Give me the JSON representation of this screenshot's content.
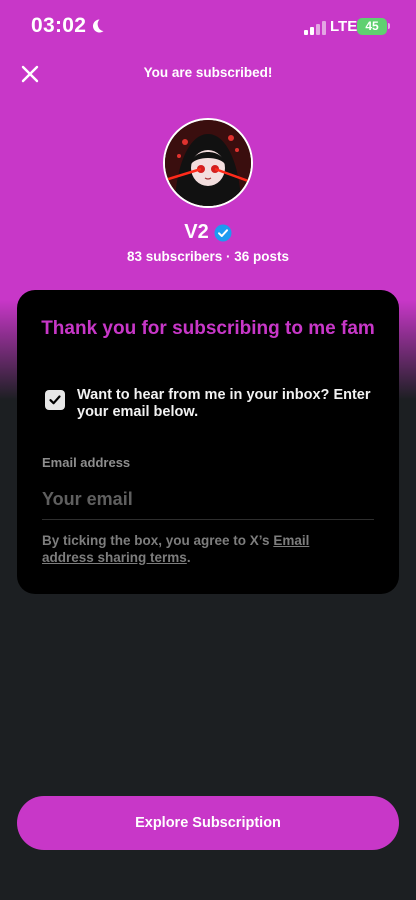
{
  "status_bar": {
    "time": "03:02",
    "network": "LTE",
    "battery": "45"
  },
  "header": {
    "title": "You are subscribed!",
    "close_icon": "close-icon"
  },
  "profile": {
    "name": "V2",
    "verified": true,
    "stats": "83 subscribers · 36 posts"
  },
  "card": {
    "title": "Thank you for subscribing to me fam",
    "checkbox_checked": true,
    "checkbox_label": "Want to hear from me in your inbox? Enter your email below.",
    "email_label": "Email address",
    "email_placeholder": "Your email",
    "email_value": "",
    "terms_prefix": "By ticking the box, you agree to X’s ",
    "terms_link": "Email address sharing terms",
    "terms_suffix": "."
  },
  "footer": {
    "button_label": "Explore Subscription"
  },
  "colors": {
    "accent": "#c837c8",
    "background": "#1c1f22",
    "card": "#000000",
    "verified_badge": "#1d9bf0",
    "battery": "#5fd070"
  }
}
